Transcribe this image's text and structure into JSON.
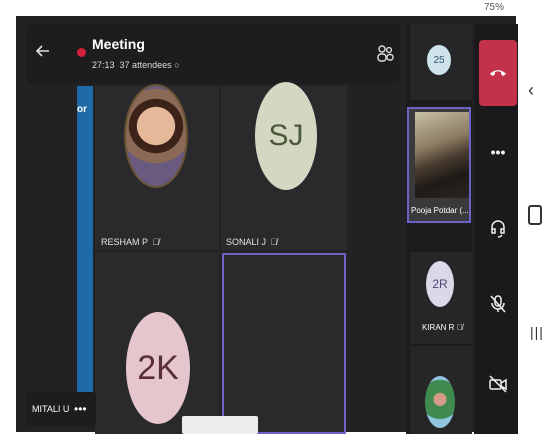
{
  "status_bar": {
    "battery": "75%"
  },
  "header": {
    "title": "Meeting",
    "elapsed": "27:13",
    "attendees": "37 attendees"
  },
  "left_edge": {
    "label": "or"
  },
  "tiles": [
    {
      "name": "RESHAM P",
      "muted": true,
      "avatar": "photo"
    },
    {
      "name": "SONALI J",
      "muted": true,
      "avatar_initials": "SJ"
    },
    {
      "name": "",
      "avatar_initials": "2K"
    },
    {
      "name": "",
      "active_speaker": true
    }
  ],
  "self_view": {
    "name": "MITALI U"
  },
  "side_participants": [
    {
      "initials": "25"
    },
    {
      "name": "Pooja Potdar (...",
      "video": true
    },
    {
      "initials": "2R",
      "name": "KIRAN R",
      "muted": true
    },
    {
      "avatar": "photo"
    }
  ],
  "controls": {
    "leave_icon": "phone-hangup-icon",
    "more_icon": "more-horizontal-icon",
    "speaker_icon": "headset-icon",
    "mic_icon": "mic-off-icon",
    "camera_icon": "camera-off-icon"
  },
  "colors": {
    "leave_red": "#c4314b",
    "active_border": "#6b63c8",
    "rec_dot": "#d4203b",
    "blue_bar": "#1f6aa5"
  }
}
